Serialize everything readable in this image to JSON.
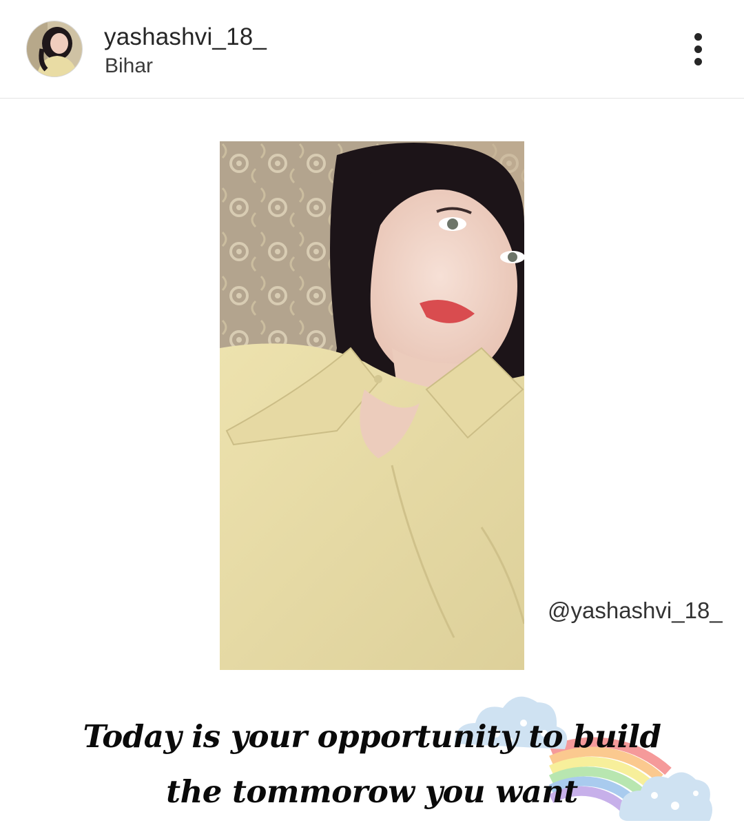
{
  "header": {
    "username": "yashashvi_18_",
    "location": "Bihar",
    "avatar_icon": "avatar-icon",
    "menu_icon": "more-vertical-icon"
  },
  "post": {
    "watermark_handle": "@yashashvi_18_",
    "quote_line_1": "Today is your opportunity to build",
    "quote_line_2": "the tommorow you want",
    "decoration_icon": "rainbow-cloud-icon"
  },
  "colors": {
    "background": "#ffffff",
    "text_primary": "#262626",
    "shirt": "#e9dca4",
    "hair": "#1c1418"
  }
}
